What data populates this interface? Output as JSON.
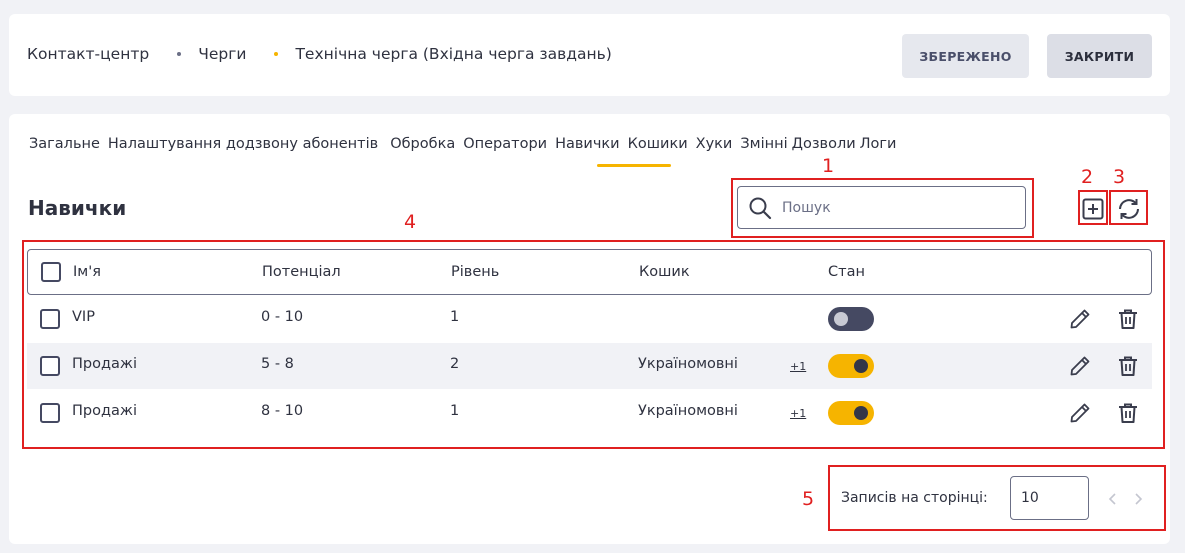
{
  "breadcrumb": {
    "items": [
      "Контакт-центр",
      "Черги",
      "Технічна черга (Вхідна черга завдань)"
    ]
  },
  "header": {
    "saved_label": "ЗБЕРЕЖЕНО",
    "close_label": "ЗАКРИТИ"
  },
  "tabs": [
    {
      "label": "Загальне"
    },
    {
      "label": "Налаштування додзвону абонентів"
    },
    {
      "label": "Обробка"
    },
    {
      "label": "Оператори"
    },
    {
      "label": "Навички",
      "active": true
    },
    {
      "label": "Кошики"
    },
    {
      "label": "Хуки"
    },
    {
      "label": "Змінні"
    },
    {
      "label": "Дозволи"
    },
    {
      "label": "Логи"
    }
  ],
  "section": {
    "title": "Навички"
  },
  "search": {
    "placeholder": "Пошук",
    "value": ""
  },
  "annotations": {
    "n1": "1",
    "n2": "2",
    "n3": "3",
    "n4": "4",
    "n5": "5"
  },
  "table": {
    "columns": [
      "Ім'я",
      "Потенціал",
      "Рівень",
      "Кошик",
      "Стан"
    ],
    "rows": [
      {
        "name": "VIP",
        "potential": "0 - 10",
        "level": "1",
        "bucket": "",
        "more": "",
        "enabled": false
      },
      {
        "name": "Продажі",
        "potential": "5 - 8",
        "level": "2",
        "bucket": "Україномовні",
        "more": "+1",
        "enabled": true
      },
      {
        "name": "Продажі",
        "potential": "8 - 10",
        "level": "1",
        "bucket": "Україномовні",
        "more": "+1",
        "enabled": true
      }
    ]
  },
  "pager": {
    "label": "Записів на сторінці:",
    "page_size": "10"
  },
  "colors": {
    "accent": "#f6b400",
    "annotation": "#e02020"
  },
  "icons": {
    "search": "search-icon",
    "add": "add-square-icon",
    "refresh": "refresh-icon",
    "edit": "pencil-icon",
    "delete": "trash-icon",
    "prev": "chevron-left-icon",
    "next": "chevron-right-icon"
  }
}
